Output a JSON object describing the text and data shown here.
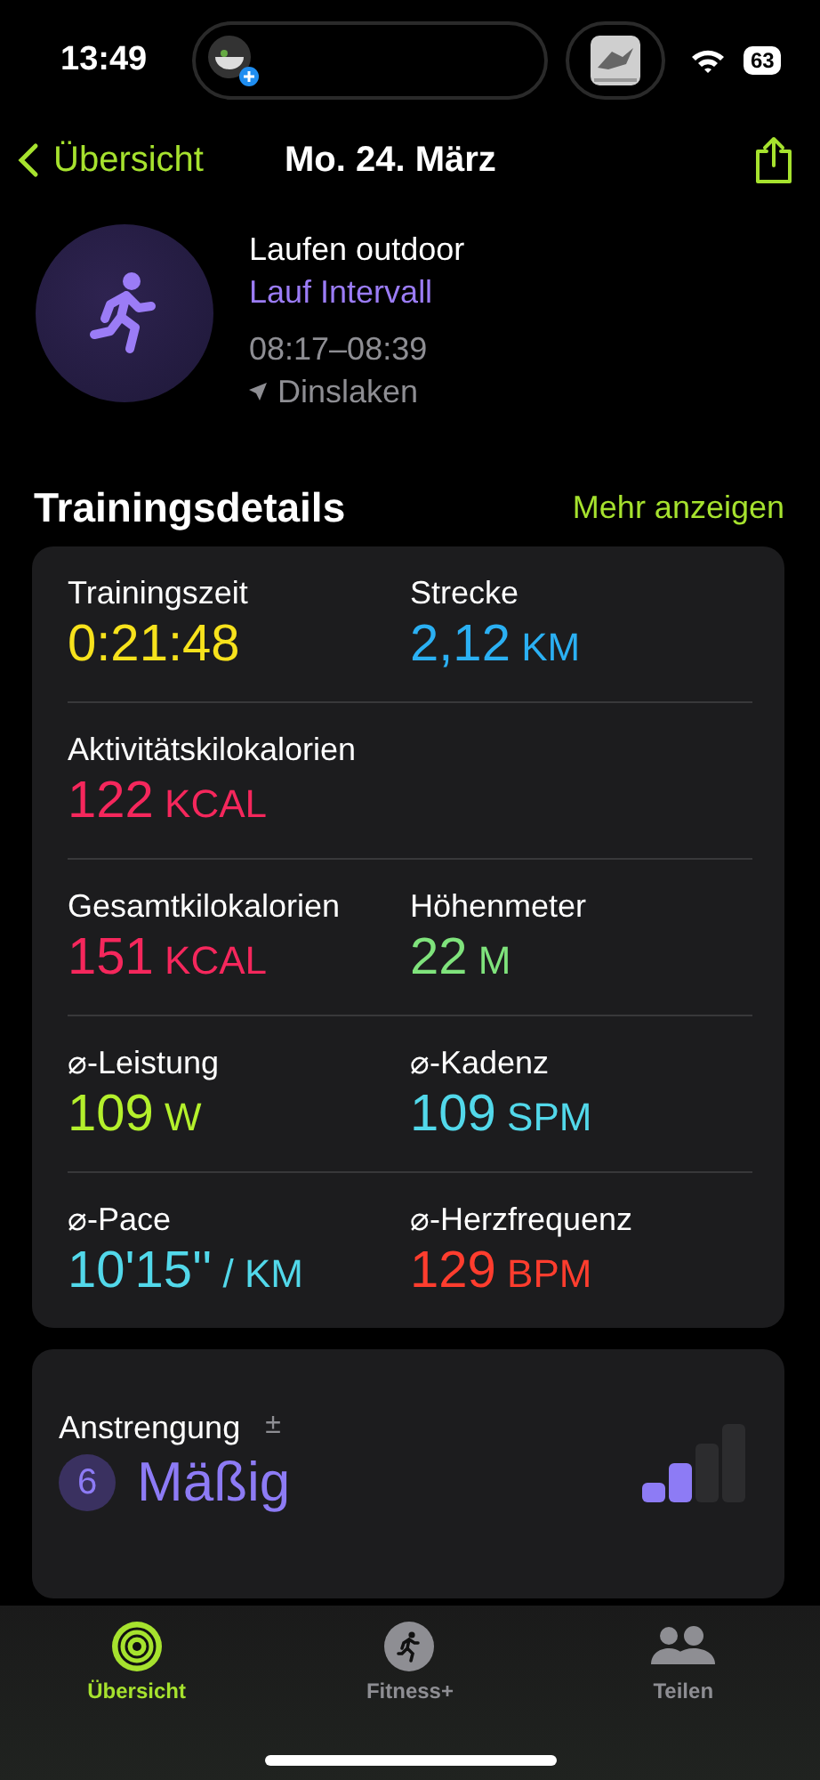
{
  "status_bar": {
    "time": "13:49",
    "battery": "63"
  },
  "nav": {
    "back": "Übersicht",
    "title": "Mo. 24. März"
  },
  "workout": {
    "type": "Laufen outdoor",
    "subtitle": "Lauf Intervall",
    "time_range": "08:17–08:39",
    "location": "Dinslaken"
  },
  "section": {
    "title": "Trainingsdetails",
    "more": "Mehr anzeigen"
  },
  "metrics": [
    [
      {
        "label": "Trainingszeit",
        "value": "0:21:48",
        "color": "#f7e21c"
      },
      {
        "label": "Strecke",
        "value": "2,12",
        "unit": "KM",
        "color": "#2bb0f3"
      }
    ],
    [
      {
        "label": "Aktivitätskilokalorien",
        "value": "122",
        "unit": "KCAL",
        "color": "#f5275c"
      }
    ],
    [
      {
        "label": "Gesamtkilokalorien",
        "value": "151",
        "unit": "KCAL",
        "color": "#f5275c"
      },
      {
        "label": "Höhenmeter",
        "value": "22",
        "unit": "M",
        "color": "#7fe37c"
      }
    ],
    [
      {
        "label": "⌀-Leistung",
        "value": "109",
        "unit": "W",
        "color": "#b4f02c"
      },
      {
        "label": "⌀-Kadenz",
        "value": "109",
        "unit": "SPM",
        "color": "#52d8ea"
      }
    ],
    [
      {
        "label": "⌀-Pace",
        "value": "10'15''",
        "unit": "/ KM",
        "color": "#52d8ea"
      },
      {
        "label": "⌀-Herzfrequenz",
        "value": "129",
        "unit": "BPM",
        "color": "#ff3d2e"
      }
    ]
  ],
  "effort": {
    "label": "Anstrengung",
    "badge": "±",
    "score": "6",
    "rating": "Mäßig",
    "level": 0.5
  },
  "tab_bar": [
    {
      "label": "Übersicht",
      "selected": true,
      "kind": "rings"
    },
    {
      "label": "Fitness+",
      "selected": false,
      "kind": "runner"
    },
    {
      "label": "Teilen",
      "selected": false,
      "kind": "people"
    }
  ]
}
